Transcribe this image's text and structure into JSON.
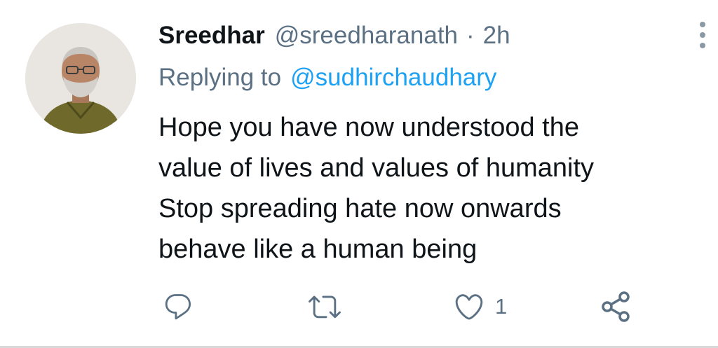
{
  "tweet": {
    "author": {
      "display_name": "Sreedhar",
      "handle": "@sreedharanath"
    },
    "separator": "·",
    "time": "2h",
    "reply_prefix": "Replying to",
    "reply_to": "@sudhirchaudhary",
    "text_lines": [
      "Hope you have now understood the",
      "value of lives and values of humanity",
      "Stop spreading hate now onwards",
      "behave like a human being"
    ],
    "actions": {
      "reply_icon": "reply-icon",
      "retweet_icon": "retweet-icon",
      "like_icon": "heart-icon",
      "like_count": "1",
      "share_icon": "share-icon"
    }
  },
  "colors": {
    "primary_text": "#0f1419",
    "secondary_text": "#5b7083",
    "link": "#1da1f2",
    "icon": "#5b7083"
  }
}
